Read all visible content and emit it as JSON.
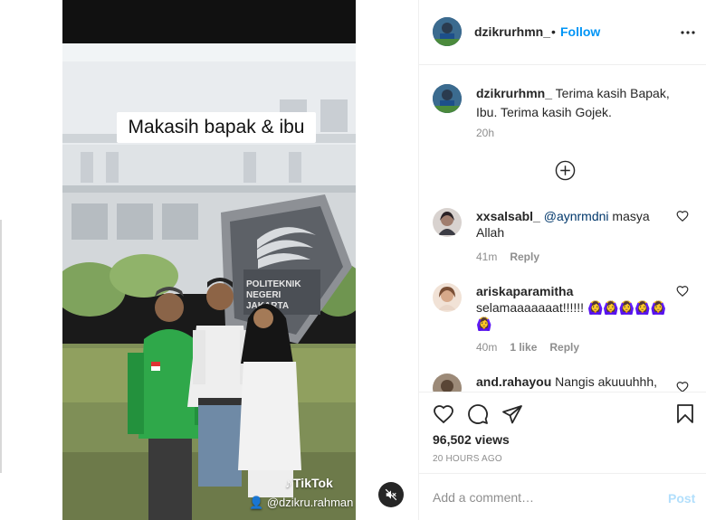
{
  "post": {
    "username": "dzikrurhmn_",
    "follow_label": "Follow",
    "caption": "Terima kasih Bapak, Ibu. Terima kasih Gojek.",
    "caption_time": "20h",
    "views": "96,502 views",
    "time_ago": "20 HOURS AGO"
  },
  "video": {
    "overlay_text": "Makasih bapak & ibu",
    "sign_line1": "POLITEKNIK",
    "sign_line2": "NEGERI",
    "sign_line3": "JAKARTA",
    "watermark_brand": "TikTok",
    "watermark_handle": "@dzikru.rahman",
    "muted": true
  },
  "comments": [
    {
      "username": "xxsalsabl_",
      "mention": "@aynrmdni",
      "text": " masya Allah",
      "time": "41m",
      "likes": "",
      "reply_label": "Reply"
    },
    {
      "username": "ariskaparamitha",
      "mention": "",
      "text": "selamaaaaaaat!!!!!! 🙆‍♀️🙆‍♀️🙆‍♀️🙆‍♀️🙆‍♀️🙆‍♀️",
      "time": "40m",
      "likes": "1 like",
      "reply_label": "Reply"
    },
    {
      "username": "and.rahayou",
      "mention": "",
      "text": "Nangis akuuuhhh,",
      "time": "",
      "likes": "",
      "reply_label": ""
    }
  ],
  "add_comment": {
    "placeholder": "Add a comment…",
    "post_label": "Post"
  },
  "colors": {
    "link_blue": "#0095f6",
    "post_disabled": "#b2dffc",
    "secondary_text": "#8e8e8e",
    "border": "#efefef"
  },
  "icons": {
    "more": "more-options-icon",
    "like": "heart-icon",
    "comment": "comment-bubble-icon",
    "share": "paper-plane-icon",
    "save": "bookmark-icon",
    "load_more": "plus-circle-icon",
    "mute": "speaker-muted-icon"
  }
}
